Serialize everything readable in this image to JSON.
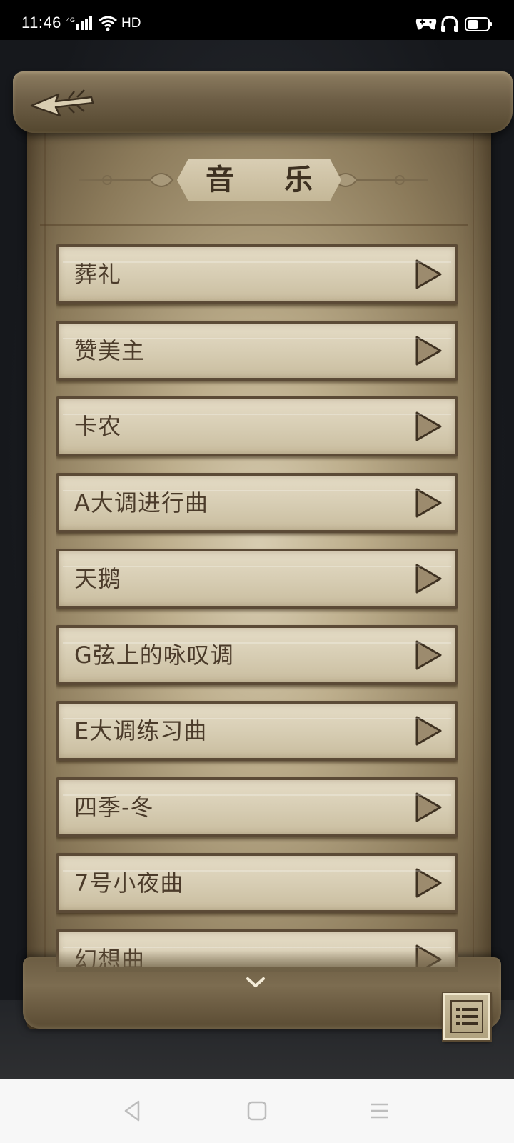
{
  "status_bar": {
    "time": "11:46",
    "network": "4G",
    "hd": "HD",
    "icons": [
      "signal-icon",
      "wifi-icon",
      "game-controller-icon",
      "headphones-icon",
      "battery-icon"
    ]
  },
  "header": {
    "title": "音 乐",
    "back_icon": "arrow-left-icon"
  },
  "songs": [
    {
      "label": "葬礼"
    },
    {
      "label": "赞美主"
    },
    {
      "label": "卡农"
    },
    {
      "label": "A大调进行曲"
    },
    {
      "label": "天鹅"
    },
    {
      "label": "G弦上的咏叹调"
    },
    {
      "label": "E大调练习曲"
    },
    {
      "label": "四季-冬"
    },
    {
      "label": "7号小夜曲"
    },
    {
      "label": "幻想曲"
    }
  ],
  "controls": {
    "scroll_more_icon": "chevron-down-icon",
    "menu_icon": "list-icon"
  },
  "nav_bar": {
    "icons": [
      "nav-back-icon",
      "nav-home-icon",
      "nav-recents-icon"
    ]
  },
  "colors": {
    "parchment": "#d8cdb2",
    "frame": "#5b4a36",
    "text": "#4b3b2a",
    "scene": "#1b1d22"
  }
}
